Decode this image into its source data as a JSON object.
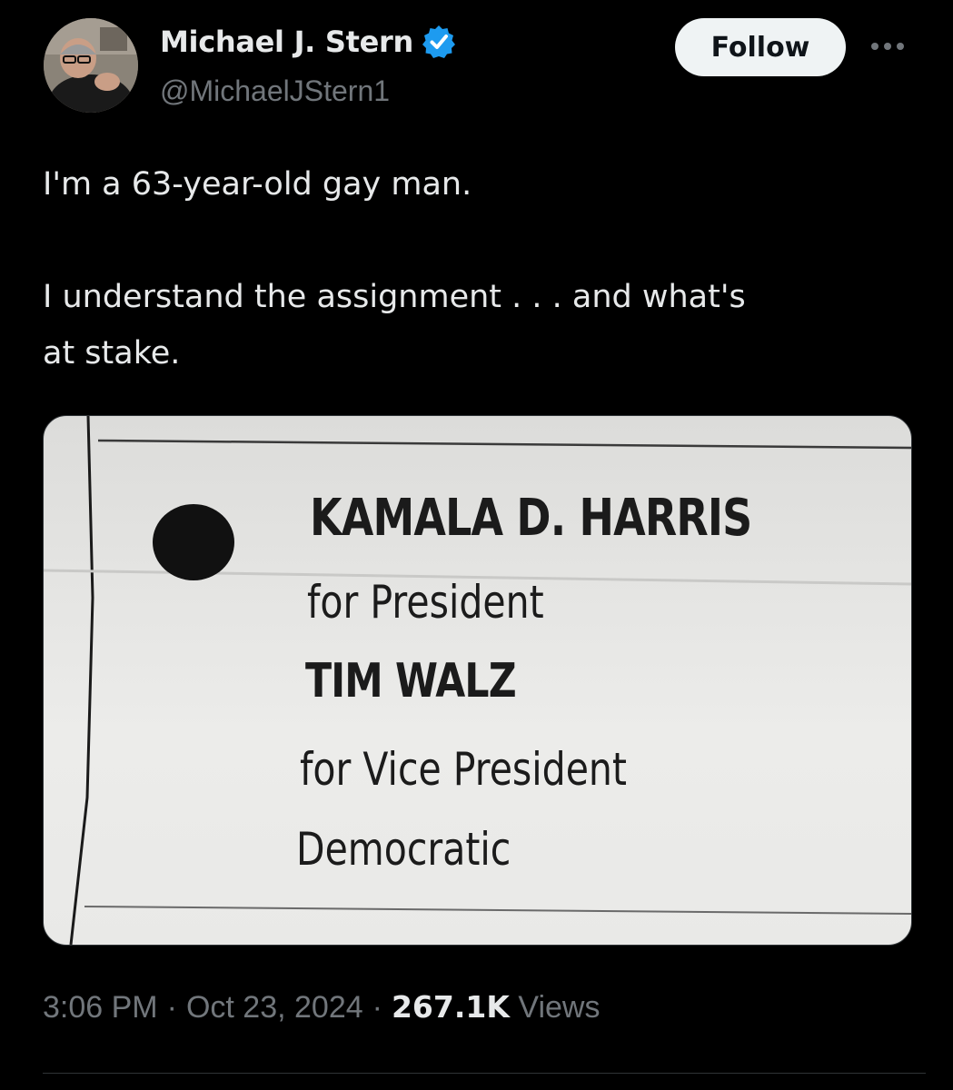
{
  "author": {
    "display_name": "Michael J. Stern",
    "handle": "@MichaelJStern1",
    "verified": true,
    "verified_color": "#1d9bf0"
  },
  "follow_label": "Follow",
  "tweet": {
    "text": "I'm a 63-year-old gay man.\n\nI understand the assignment . . . and what's\nat stake."
  },
  "ballot": {
    "candidate_1": "KAMALA D. HARRIS",
    "role_1": "for President",
    "candidate_2": "TIM WALZ",
    "role_2": "for Vice President",
    "party": "Democratic"
  },
  "meta": {
    "time": "3:06 PM",
    "separator_1": "·",
    "date": "Oct 23, 2024",
    "separator_2": "·",
    "views_count": "267.1K",
    "views_label": "Views"
  },
  "icons": {
    "verified": "verified-badge-icon",
    "more": "more-horizontal-icon"
  }
}
